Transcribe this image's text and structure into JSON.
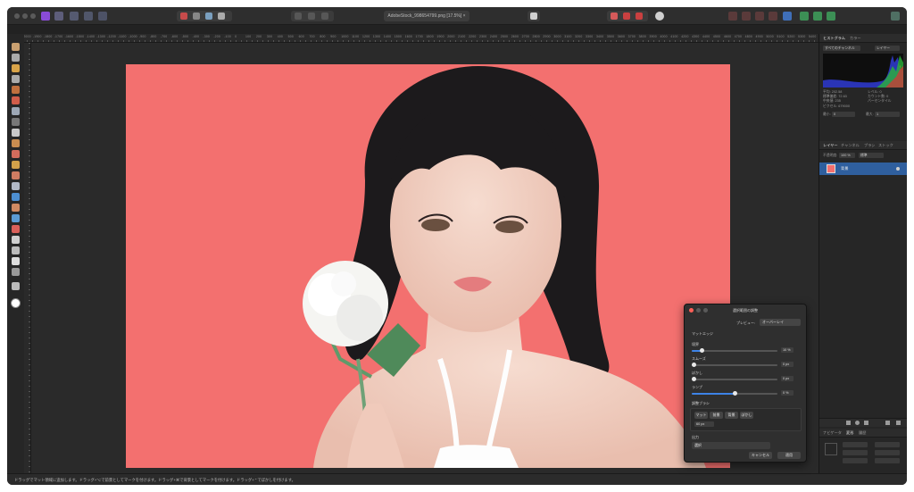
{
  "document": {
    "tab_title": "AdobeStock_998654799.png [17.5%] ×"
  },
  "ruler": {
    "labels": [
      "-2000",
      "-1900",
      "-1800",
      "-1700",
      "-1600",
      "-1500",
      "-1400",
      "-1300",
      "-1200",
      "-1100",
      "-1000",
      "-900",
      "-800",
      "-700",
      "-600",
      "-500",
      "-400",
      "-300",
      "-200",
      "-100",
      "0",
      "100",
      "200",
      "300",
      "400",
      "500",
      "600",
      "700",
      "800",
      "900",
      "1000",
      "1100",
      "1200",
      "1300",
      "1400",
      "1500",
      "1600",
      "1700",
      "1800",
      "1900",
      "2000",
      "2100",
      "2200",
      "2300",
      "2400",
      "2500",
      "2600",
      "2700",
      "2800",
      "2900",
      "3000",
      "3100",
      "3200",
      "3300",
      "3400",
      "3500",
      "3600",
      "3700",
      "3800",
      "3900",
      "4000",
      "4100",
      "4200",
      "4300",
      "4400",
      "4500",
      "4600",
      "4700",
      "4800",
      "4900",
      "5000",
      "5100",
      "5200",
      "5300",
      "5400"
    ]
  },
  "histogram_panel": {
    "tabs": [
      "ヒストグラム",
      "カラー"
    ],
    "channel_select": "すべてのチャンネル",
    "source_select": "レイヤー",
    "warning_icon": "!",
    "stats_left": [
      "平均: 202.58",
      "標準偏差: 72.63",
      "中央値: 235",
      "ピクセル: 679000"
    ],
    "stats_right": [
      "レベル: 0",
      "カウント数: 0",
      "パーセンタイル"
    ],
    "min_label": "最小:",
    "min_value": "0",
    "max_label": "最大:",
    "max_value": "1"
  },
  "layers_panel": {
    "tabs": [
      "レイヤー",
      "チャンネル",
      "ブラシ",
      "ストック"
    ],
    "opacity_label": "不透明度:",
    "opacity_value": "100 %",
    "blend_mode": "標準",
    "layer_name": "背景"
  },
  "navigator_panel": {
    "tabs": [
      "ナビゲータ",
      "変形",
      "履歴"
    ]
  },
  "dialog": {
    "title": "選択範囲の調整",
    "preview_label": "プレビュー:",
    "preview_value": "オーバーレイ",
    "matting_label": "マットエッジ",
    "rows": [
      {
        "label": "境界",
        "value": "10 %",
        "fraction": 0.12
      },
      {
        "label": "スムーズ",
        "value": "0 px",
        "fraction": 0.0
      },
      {
        "label": "ぼかし",
        "value": "0 px",
        "fraction": 0.0
      },
      {
        "label": "ランプ",
        "value": "0 %",
        "fraction": 0.5
      }
    ],
    "brush_section_label": "調整ブラシ",
    "brush_buttons": [
      "マット",
      "前景",
      "背景",
      "ぼかし"
    ],
    "brush_size": "60 px",
    "output_label": "出力",
    "output_value": "選択",
    "cancel_label": "キャンセル",
    "apply_label": "適用"
  },
  "status": {
    "text": "ドラッグでマット領域に追加します。ドラッグ+⌥で前景としてマークを付けます。ドラッグ+⌘で背景としてマークを付けます。ドラッグ+⌃でぼかしを付けます。"
  },
  "colors": {
    "canvas_bg": "#f3706f",
    "accent": "#3d83e6",
    "purple_app_icon": "#8a4bd6"
  }
}
